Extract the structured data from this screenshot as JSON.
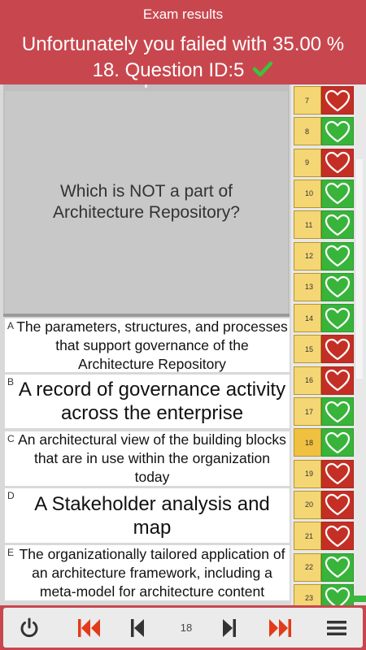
{
  "header": {
    "title": "Exam results",
    "status": "Unfortunately you failed with 35.00 %",
    "question": "18. Question ID:5",
    "question_icon": "check-icon",
    "status_color": "#c8474e"
  },
  "question": {
    "text": "Which is NOT a part of Architecture Repository?"
  },
  "answers": [
    {
      "letter": "A",
      "text": "The parameters, structures, and processes that support governance of the Architecture Repository"
    },
    {
      "letter": "B",
      "text": "A record of governance activity across the enterprise"
    },
    {
      "letter": "C",
      "text": "An architectural view of the building blocks that are in use within the organization today"
    },
    {
      "letter": "D",
      "text": "A Stakeholder analysis and map",
      "correct": true
    },
    {
      "letter": "E",
      "text": "The organizationally tailored application of an architecture framework, including a meta-model for architecture content"
    }
  ],
  "question_list": [
    {
      "num": "7",
      "result": "wrong"
    },
    {
      "num": "8",
      "result": "correct"
    },
    {
      "num": "9",
      "result": "wrong"
    },
    {
      "num": "10",
      "result": "correct"
    },
    {
      "num": "11",
      "result": "correct"
    },
    {
      "num": "12",
      "result": "correct"
    },
    {
      "num": "13",
      "result": "correct"
    },
    {
      "num": "14",
      "result": "correct"
    },
    {
      "num": "15",
      "result": "wrong"
    },
    {
      "num": "16",
      "result": "wrong"
    },
    {
      "num": "17",
      "result": "correct"
    },
    {
      "num": "18",
      "result": "correct",
      "current": true
    },
    {
      "num": "19",
      "result": "wrong"
    },
    {
      "num": "20",
      "result": "wrong"
    },
    {
      "num": "21",
      "result": "wrong"
    },
    {
      "num": "22",
      "result": "correct"
    },
    {
      "num": "23",
      "result": "correct"
    }
  ],
  "nav": {
    "power_icon": "power-icon",
    "first_icon": "skip-to-first-icon",
    "prev_icon": "previous-icon",
    "page": "18",
    "next_icon": "next-icon",
    "last_icon": "skip-to-last-icon",
    "menu_icon": "menu-icon"
  },
  "colors": {
    "correct": "#38b43a",
    "wrong": "#c42f25",
    "accent": "#c8474e"
  }
}
